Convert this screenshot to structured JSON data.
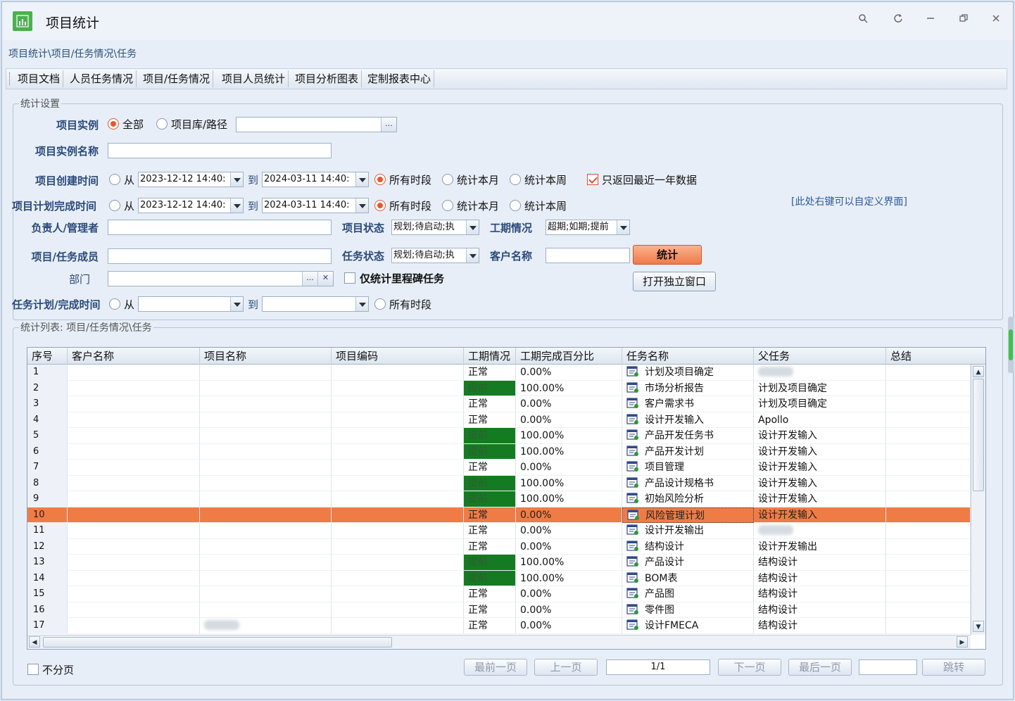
{
  "window": {
    "title": "项目统计"
  },
  "breadcrumb": "项目统计\\项目/任务情况\\任务",
  "tabs": [
    "项目文档",
    "人员任务情况",
    "项目/任务情况",
    "项目人员统计",
    "项目分析图表",
    "定制报表中心"
  ],
  "settings": {
    "legend": "统计设置",
    "instance_label": "项目实例",
    "instance_all": "全部",
    "instance_repo": "项目库/路径",
    "instance_name_label": "项目实例名称",
    "create_time_label": "项目创建时间",
    "plan_finish_label": "项目计划完成时间",
    "from": "从",
    "to": "到",
    "create_from": "2023-12-12 14:40:",
    "create_to": "2024-03-11 14:40:",
    "plan_from": "2023-12-12 14:40:",
    "plan_to": "2024-03-11 14:40:",
    "all_period": "所有时段",
    "this_month": "统计本月",
    "this_week": "统计本周",
    "recent_year": "只返回最近一年数据",
    "customize_hint": "[此处右键可以自定义界面]",
    "owner_label": "负责人/管理者",
    "project_status_label": "项目状态",
    "project_status_value": "规划;待启动;执",
    "schedule_label": "工期情况",
    "schedule_value": "超期;如期;提前",
    "member_label": "项目/任务成员",
    "task_status_label": "任务状态",
    "task_status_value": "规划;待启动;执",
    "customer_label": "客户名称",
    "stat_button": "统计",
    "dept_label": "部门",
    "milestone_only": "仅统计里程碑任务",
    "open_window_button": "打开独立窗口",
    "task_time_label": "任务计划/完成时间",
    "task_from": "从",
    "task_to": "到",
    "task_all_period": "所有时段",
    "browse_glyph": "...",
    "clear_glyph": "✕"
  },
  "list": {
    "legend": "统计列表: 项目/任务情况\\任务",
    "columns": [
      "序号",
      "客户名称",
      "项目名称",
      "项目编码",
      "工期情况",
      "工期完成百分比",
      "任务名称",
      "父任务",
      "总结"
    ],
    "rows": [
      {
        "no": "1",
        "status": "正常",
        "pct": "0.00%",
        "task": "计划及项目确定",
        "parent": ""
      },
      {
        "no": "2",
        "status": "提前",
        "pct": "100.00%",
        "task": "市场分析报告",
        "parent": "计划及项目确定"
      },
      {
        "no": "3",
        "status": "正常",
        "pct": "0.00%",
        "task": "客户需求书",
        "parent": "计划及项目确定"
      },
      {
        "no": "4",
        "status": "正常",
        "pct": "0.00%",
        "task": "设计开发输入",
        "parent": "Apollo"
      },
      {
        "no": "5",
        "status": "提前",
        "pct": "100.00%",
        "task": "产品开发任务书",
        "parent": "设计开发输入"
      },
      {
        "no": "6",
        "status": "提前",
        "pct": "100.00%",
        "task": "产品开发计划",
        "parent": "设计开发输入"
      },
      {
        "no": "7",
        "status": "正常",
        "pct": "0.00%",
        "task": "项目管理",
        "parent": "设计开发输入"
      },
      {
        "no": "8",
        "status": "提前",
        "pct": "100.00%",
        "task": "产品设计规格书",
        "parent": "设计开发输入"
      },
      {
        "no": "9",
        "status": "提前",
        "pct": "100.00%",
        "task": "初始风险分析",
        "parent": "设计开发输入"
      },
      {
        "no": "10",
        "status": "正常",
        "pct": "0.00%",
        "task": "风险管理计划",
        "parent": "设计开发输入"
      },
      {
        "no": "11",
        "status": "正常",
        "pct": "0.00%",
        "task": "设计开发输出",
        "parent": ""
      },
      {
        "no": "12",
        "status": "正常",
        "pct": "0.00%",
        "task": "结构设计",
        "parent": "设计开发输出"
      },
      {
        "no": "13",
        "status": "提前",
        "pct": "100.00%",
        "task": "产品设计",
        "parent": "结构设计"
      },
      {
        "no": "14",
        "status": "提前",
        "pct": "100.00%",
        "task": "BOM表",
        "parent": "结构设计"
      },
      {
        "no": "15",
        "status": "正常",
        "pct": "0.00%",
        "task": "产品图",
        "parent": "结构设计"
      },
      {
        "no": "16",
        "status": "正常",
        "pct": "0.00%",
        "task": "零件图",
        "parent": "结构设计"
      },
      {
        "no": "17",
        "status": "正常",
        "pct": "0.00%",
        "task": "设计FMECA",
        "parent": "结构设计"
      }
    ],
    "selected_row": "10",
    "status_early_color": "#157b22",
    "selected_color": "#ef7c45"
  },
  "pager": {
    "no_paging": "不分页",
    "first": "最前一页",
    "prev": "上一页",
    "page": "1/1",
    "next": "下一页",
    "last": "最后一页",
    "jump": "跳转"
  }
}
